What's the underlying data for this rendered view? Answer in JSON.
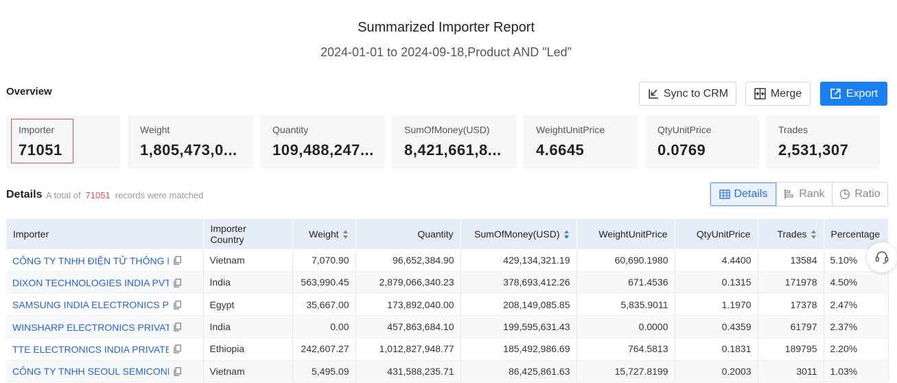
{
  "report": {
    "title": "Summarized Importer Report",
    "subtitle": "2024-01-01 to 2024-09-18,Product AND \"Led\""
  },
  "overview": {
    "label": "Overview",
    "buttons": {
      "sync": "Sync to CRM",
      "merge": "Merge",
      "export": "Export"
    },
    "stats": [
      {
        "label": "Importer",
        "value": "71051"
      },
      {
        "label": "Weight",
        "value": "1,805,473,0..."
      },
      {
        "label": "Quantity",
        "value": "109,488,247..."
      },
      {
        "label": "SumOfMoney(USD)",
        "value": "8,421,661,8..."
      },
      {
        "label": "WeightUnitPrice",
        "value": "4.6645"
      },
      {
        "label": "QtyUnitPrice",
        "value": "0.0769"
      },
      {
        "label": "Trades",
        "value": "2,531,307"
      }
    ]
  },
  "details": {
    "label": "Details",
    "info_prefix": "A total of",
    "count": "71051",
    "info_suffix": "records were matched",
    "tabs": {
      "details": "Details",
      "rank": "Rank",
      "ratio": "Ratio"
    }
  },
  "table": {
    "headers": {
      "importer": "Importer",
      "country_1": "Importer",
      "country_2": "Country",
      "weight": "Weight",
      "quantity": "Quantity",
      "sum": "SumOfMoney(USD)",
      "wup": "WeightUnitPrice",
      "qup": "QtyUnitPrice",
      "trades": "Trades",
      "percentage": "Percentage"
    },
    "rows": [
      {
        "importer": "CÔNG TY TNHH ĐIỆN TỬ THÔNG MINH",
        "country": "Vietnam",
        "weight": "7,070.90",
        "quantity": "96,652,384.90",
        "sum": "429,134,321.19",
        "wup": "60,690.1980",
        "qup": "4.4400",
        "trades": "13584",
        "pct": "5.10%"
      },
      {
        "importer": "DIXON TECHNOLOGIES INDIA PVT LTD",
        "country": "India",
        "weight": "563,990.45",
        "quantity": "2,879,066,340.23",
        "sum": "378,693,412.26",
        "wup": "671.4536",
        "qup": "0.1315",
        "trades": "171978",
        "pct": "4.50%"
      },
      {
        "importer": "SAMSUNG INDIA ELECTRONICS PVT LTD",
        "country": "Egypt",
        "weight": "35,667.00",
        "quantity": "173,892,040.00",
        "sum": "208,149,085.85",
        "wup": "5,835.9011",
        "qup": "1.1970",
        "trades": "17378",
        "pct": "2.47%"
      },
      {
        "importer": "WINSHARP ELECTRONICS PRIVATE LIMITED",
        "country": "India",
        "weight": "0.00",
        "quantity": "457,863,684.10",
        "sum": "199,595,631.43",
        "wup": "0.0000",
        "qup": "0.4359",
        "trades": "61797",
        "pct": "2.37%"
      },
      {
        "importer": "TTE ELECTRONICS INDIA PRIVATE LIMITED",
        "country": "Ethiopia",
        "weight": "242,607.27",
        "quantity": "1,012,827,948.77",
        "sum": "185,492,986.69",
        "wup": "764.5813",
        "qup": "0.1831",
        "trades": "189795",
        "pct": "2.20%"
      },
      {
        "importer": "CÔNG TY TNHH SEOUL SEMICONDUCTOR",
        "country": "Vietnam",
        "weight": "5,495.09",
        "quantity": "431,588,235.71",
        "sum": "86,425,861.63",
        "wup": "15,727.8199",
        "qup": "0.2003",
        "trades": "3011",
        "pct": "1.03%"
      }
    ]
  },
  "colors": {
    "accent": "#1b7ef1",
    "highlight": "#e0544f",
    "link": "#2563d6",
    "header_bg": "#e7ecf9"
  }
}
